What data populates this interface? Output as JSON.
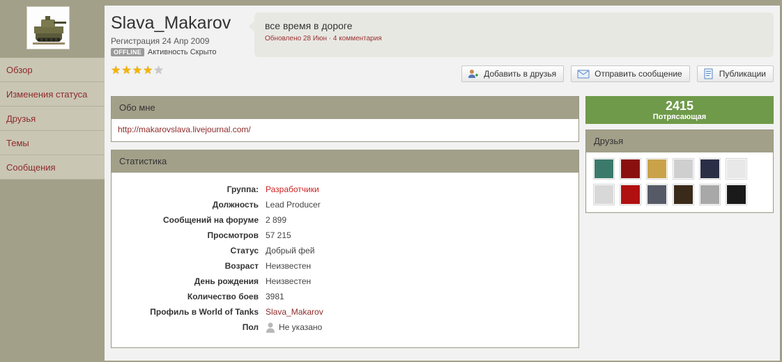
{
  "profile": {
    "username": "Slava_Makarov",
    "joined": "Регистрация 24 Апр 2009",
    "offline_badge": "OFFLINE",
    "activity": "Активность Скрыто",
    "rating_stars": 4,
    "rating_max": 5
  },
  "status": {
    "text": "все время в дороге",
    "meta": "Обновлено 28 Июн · 4 комментария"
  },
  "nav": {
    "items": [
      {
        "label": "Обзор",
        "active": true
      },
      {
        "label": "Изменения статуса",
        "active": false
      },
      {
        "label": "Друзья",
        "active": false
      },
      {
        "label": "Темы",
        "active": false
      },
      {
        "label": "Сообщения",
        "active": false
      }
    ]
  },
  "actions": {
    "add_friend": "Добавить в друзья",
    "send_message": "Отправить сообщение",
    "publications": "Публикации"
  },
  "about": {
    "title": "Обо мне",
    "link": "http://makarovslava.livejournal.com/"
  },
  "stats": {
    "title": "Статистика",
    "rows": [
      {
        "label": "Группа:",
        "value": "Разработчики"
      },
      {
        "label": "Должность",
        "value": "Lead Producer"
      },
      {
        "label": "Сообщений на форуме",
        "value": "2  899"
      },
      {
        "label": "Просмотров",
        "value": "57  215"
      },
      {
        "label": "Статус",
        "value": "Добрый фей"
      },
      {
        "label": "Возраст",
        "value": "Неизвестен"
      },
      {
        "label": "День рождения",
        "value": "Неизвестен"
      },
      {
        "label": "Количество боев",
        "value": "3981"
      },
      {
        "label": "Профиль в World of Tanks",
        "value": "Slava_Makarov"
      },
      {
        "label": "Пол",
        "value": "Не указано"
      }
    ]
  },
  "reputation": {
    "value": "2415",
    "label": "Потрясающая",
    "color": "#6f9a4a"
  },
  "friends": {
    "title": "Друзья",
    "avatar_colors": [
      "#3b7a6a",
      "#8a1010",
      "#c9a24a",
      "#cfcfcf",
      "#2b2f45",
      "#e8e8e8",
      "#d8d8d8",
      "#b01010",
      "#555a66",
      "#3a2a1a",
      "#a8a8a8",
      "#1a1a1a"
    ]
  },
  "colors": {
    "accent_red": "#8f2a2a",
    "group_red": "#cc2222",
    "header_bg": "#a3a089",
    "star": "#f5b400"
  }
}
